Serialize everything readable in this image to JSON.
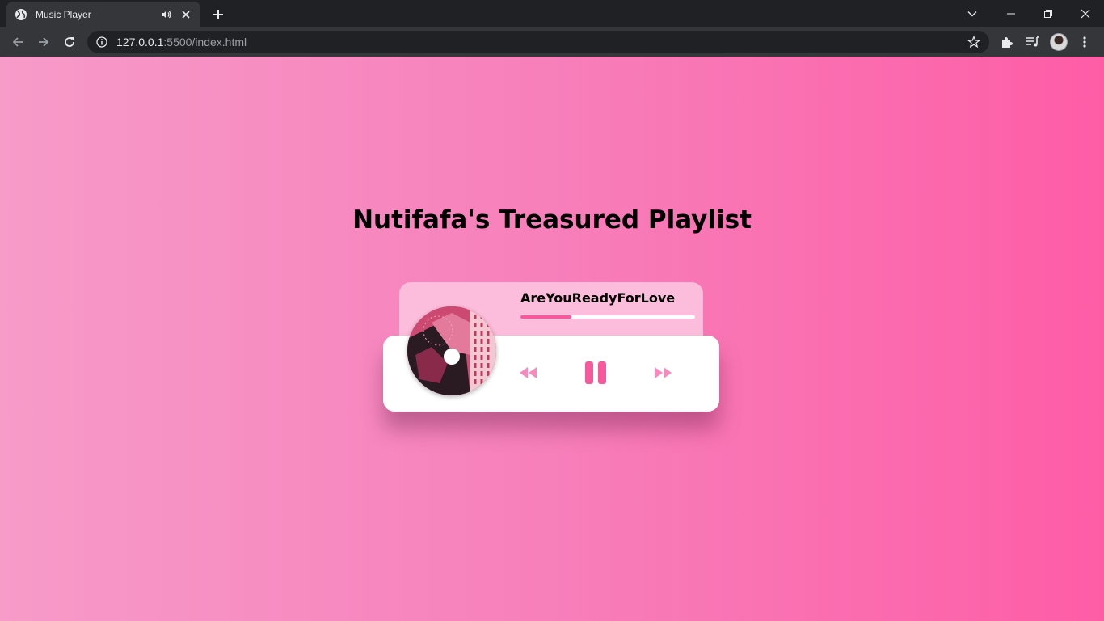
{
  "browser": {
    "tab_title": "Music Player",
    "url_host": "127.0.0.1",
    "url_rest": ":5500/index.html"
  },
  "page": {
    "heading": "Nutifafa's Treasured Playlist"
  },
  "player": {
    "song_title": "AreYouReadyForLove",
    "progress": 0.29,
    "state": "playing",
    "album_art_icon": "album-cover",
    "controls": [
      "prev-icon",
      "pause-icon",
      "next-icon"
    ]
  },
  "colors": {
    "accent": "#f75a9c",
    "control_light": "#f889bc",
    "card_top": "#fcbcdb"
  }
}
